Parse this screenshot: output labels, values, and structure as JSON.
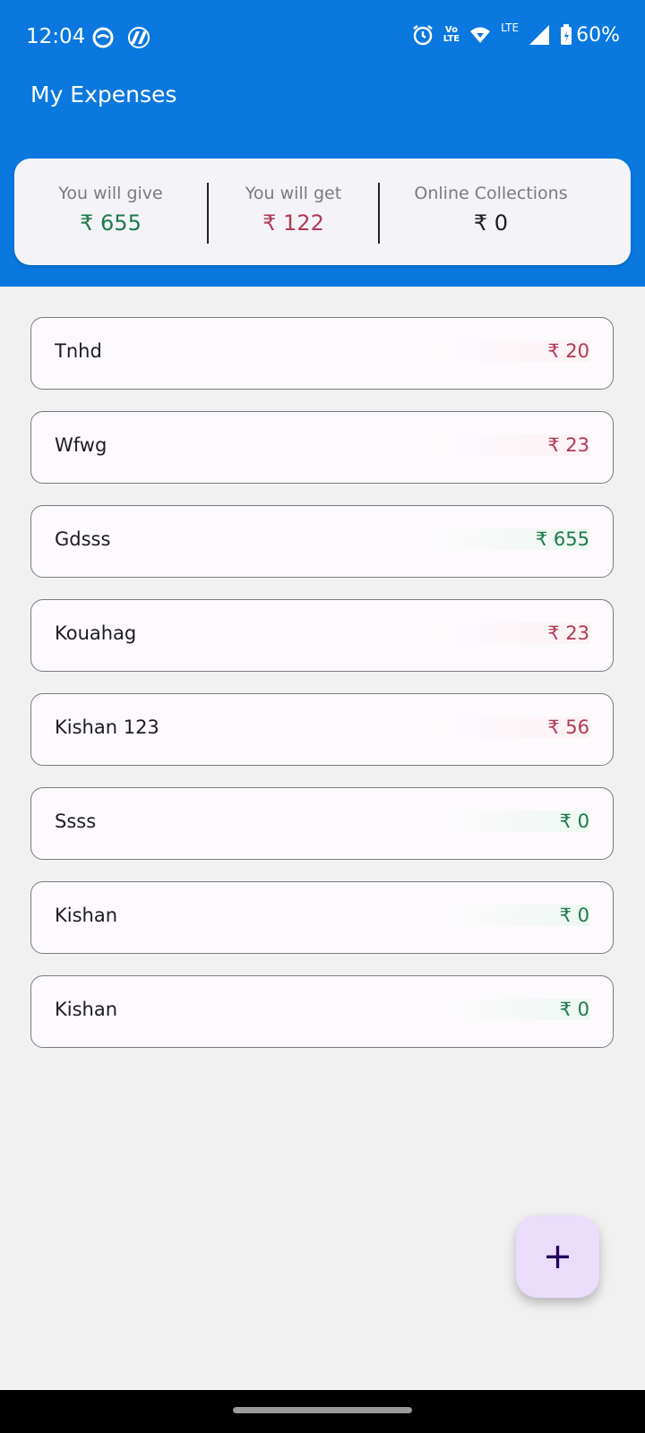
{
  "status_bar": {
    "time": "12:04",
    "network_label": "LTE",
    "volte_label_top": "Vo",
    "volte_label_bottom": "LTE",
    "battery": "60%"
  },
  "app": {
    "title": "My Expenses"
  },
  "summary": {
    "give_label": "You will give",
    "give_value": "₹ 655",
    "get_label": "You will get",
    "get_value": "₹ 122",
    "online_label": "Online Collections",
    "online_value": "₹ 0"
  },
  "colors": {
    "header": "#0a78df",
    "give_green": "#1f7a4d",
    "get_red": "#b03a55"
  },
  "entries": [
    {
      "name": "Tnhd",
      "amount": "₹ 20",
      "type": "red"
    },
    {
      "name": "Wfwg",
      "amount": "₹ 23",
      "type": "red"
    },
    {
      "name": "Gdsss",
      "amount": "₹ 655",
      "type": "green"
    },
    {
      "name": "Kouahag",
      "amount": "₹ 23",
      "type": "red"
    },
    {
      "name": "Kishan 123",
      "amount": "₹ 56",
      "type": "red"
    },
    {
      "name": "Ssss",
      "amount": "₹ 0",
      "type": "green"
    },
    {
      "name": "Kishan",
      "amount": "₹ 0",
      "type": "green"
    },
    {
      "name": "Kishan",
      "amount": "₹ 0",
      "type": "green"
    }
  ],
  "fab": {
    "icon": "plus-icon",
    "symbol": "+"
  }
}
